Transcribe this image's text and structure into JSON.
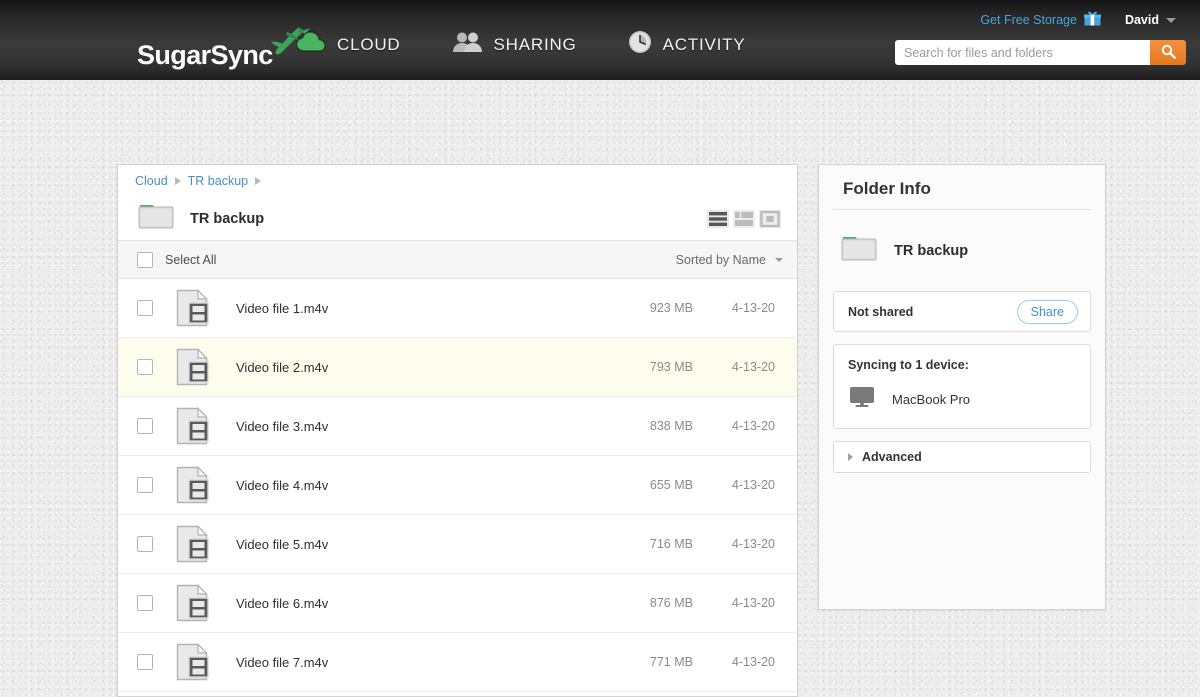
{
  "header": {
    "brand": "SugarSync",
    "brand_icon": "hummingbird-logo-icon",
    "nav": [
      {
        "label": "CLOUD",
        "icon": "cloud-icon",
        "active": true
      },
      {
        "label": "SHARING",
        "icon": "people-icon",
        "active": false
      },
      {
        "label": "ACTIVITY",
        "icon": "clock-icon",
        "active": false
      }
    ],
    "free_storage": {
      "label": "Get Free Storage",
      "icon": "gift-icon"
    },
    "user": {
      "name": "David",
      "icon": "chevron-down-icon"
    },
    "search": {
      "value": "",
      "placeholder": "Search for files and folders",
      "button_icon": "search-icon"
    }
  },
  "breadcrumb": {
    "items": [
      "Cloud",
      "TR backup"
    ]
  },
  "folder": {
    "name": "TR backup",
    "icon": "folder-icon",
    "views": [
      {
        "name": "list-view",
        "active": true
      },
      {
        "name": "details-view",
        "active": false
      },
      {
        "name": "thumbnail-view",
        "active": false
      }
    ]
  },
  "toolbar": {
    "select_all": "Select All",
    "sort": "Sorted by Name"
  },
  "files": [
    {
      "name": "Video file 1.m4v",
      "size": "923 MB",
      "date": "4-13-20",
      "icon": "video-file-icon",
      "highlight": false
    },
    {
      "name": "Video file 2.m4v",
      "size": "793 MB",
      "date": "4-13-20",
      "icon": "video-file-icon",
      "highlight": true
    },
    {
      "name": "Video file 3.m4v",
      "size": "838 MB",
      "date": "4-13-20",
      "icon": "video-file-icon",
      "highlight": false
    },
    {
      "name": "Video file 4.m4v",
      "size": "655 MB",
      "date": "4-13-20",
      "icon": "video-file-icon",
      "highlight": false
    },
    {
      "name": "Video file 5.m4v",
      "size": "716 MB",
      "date": "4-13-20",
      "icon": "video-file-icon",
      "highlight": false
    },
    {
      "name": "Video file 6.m4v",
      "size": "876 MB",
      "date": "4-13-20",
      "icon": "video-file-icon",
      "highlight": false
    },
    {
      "name": "Video file 7.m4v",
      "size": "771 MB",
      "date": "4-13-20",
      "icon": "video-file-icon",
      "highlight": false
    }
  ],
  "info": {
    "title": "Folder Info",
    "folder_name": "TR backup",
    "shared_status": "Not shared",
    "share_button": "Share",
    "sync_title": "Syncing to 1 device:",
    "devices": [
      {
        "name": "MacBook Pro",
        "icon": "monitor-icon"
      }
    ],
    "advanced": "Advanced"
  },
  "colors": {
    "brand_green": "#3ea45c",
    "accent_orange": "#e87722",
    "link_blue": "#4a90c4",
    "free_storage_blue": "#46a5dd",
    "header_dark": "#2b2b2b",
    "row_highlight": "#fdfdee"
  }
}
